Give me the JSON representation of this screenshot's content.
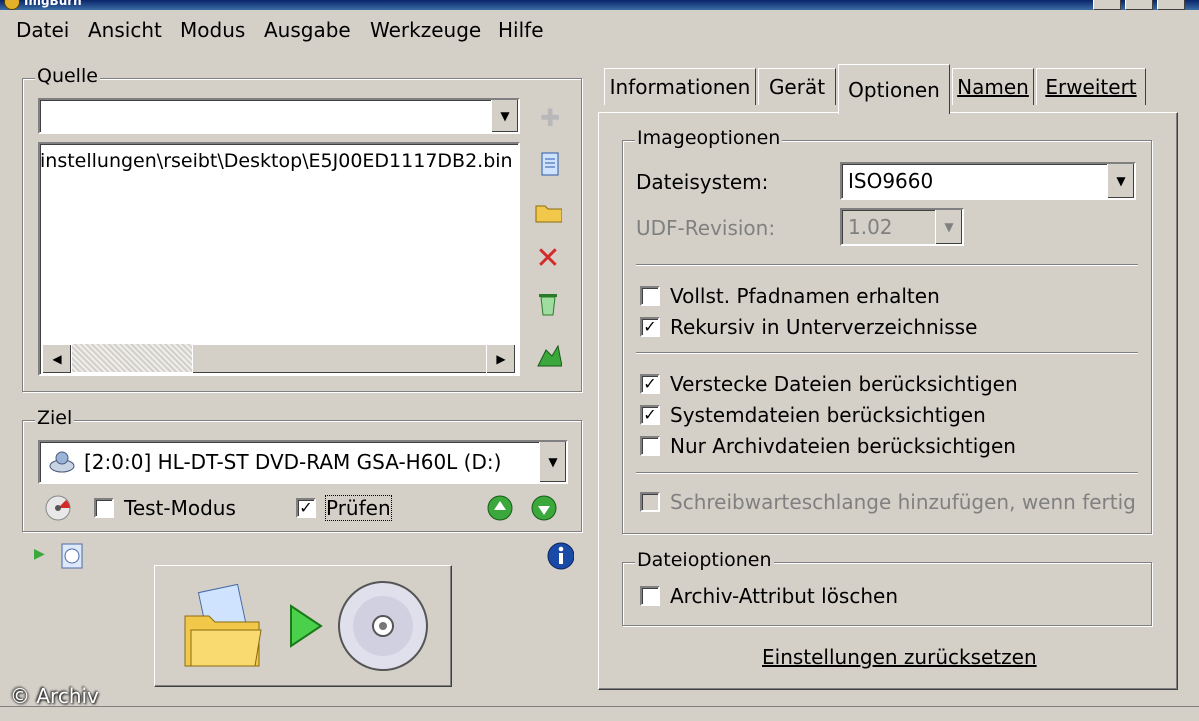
{
  "window": {
    "title": "ImgBurn"
  },
  "menu": [
    "Datei",
    "Ansicht",
    "Modus",
    "Ausgabe",
    "Werkzeuge",
    "Hilfe"
  ],
  "source": {
    "label": "Quelle",
    "combo_value": "",
    "file_path": "instellungen\\rseibt\\Desktop\\E5J00ED1117DB2.bin"
  },
  "destination": {
    "label": "Ziel",
    "drive": "[2:0:0] HL-DT-ST DVD-RAM GSA-H60L (D:)",
    "test_mode_label": "Test-Modus",
    "test_mode_checked": false,
    "verify_label": "Prüfen",
    "verify_checked": true
  },
  "tabs": [
    "Informationen",
    "Gerät",
    "Optionen",
    "Namen",
    "Erweitert"
  ],
  "active_tab": "Optionen",
  "image_options": {
    "label": "Imageoptionen",
    "filesystem_label": "Dateisystem:",
    "filesystem_value": "ISO9660",
    "udf_label": "UDF-Revision:",
    "udf_value": "1.02",
    "checkboxes": [
      {
        "label": "Vollst. Pfadnamen erhalten",
        "checked": false,
        "disabled": false
      },
      {
        "label": "Rekursiv in Unterverzeichnisse",
        "checked": true,
        "disabled": false
      },
      {
        "label": "Verstecke Dateien berücksichtigen",
        "checked": true,
        "disabled": false
      },
      {
        "label": "Systemdateien berücksichtigen",
        "checked": true,
        "disabled": false
      },
      {
        "label": "Nur Archivdateien berücksichtigen",
        "checked": false,
        "disabled": false
      },
      {
        "label": "Schreibwarteschlange hinzufügen, wenn fertig",
        "checked": false,
        "disabled": true
      }
    ]
  },
  "file_options": {
    "label": "Dateioptionen",
    "archive_label": "Archiv-Attribut löschen",
    "archive_checked": false
  },
  "reset_link": "Einstellungen zurücksetzen",
  "watermark": "© Archiv",
  "colors": {
    "face": "#d4d0c8",
    "error_red": "#d42a2a",
    "accent_green": "#3aa83a"
  }
}
